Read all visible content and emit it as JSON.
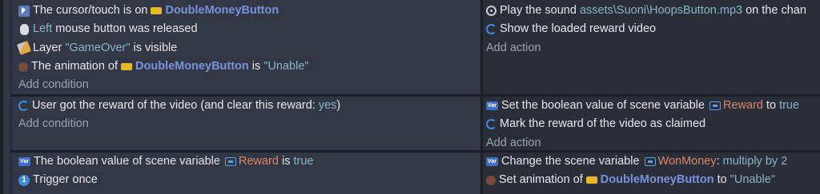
{
  "events": [
    {
      "conditions": [
        {
          "icon": "cursor-icon",
          "parts": [
            {
              "t": "The cursor/touch is on"
            },
            {
              "chip": true
            },
            {
              "t": "DoubleMoneyButton",
              "c": "obj"
            }
          ]
        },
        {
          "icon": "mouse-icon",
          "parts": [
            {
              "t": "Left",
              "c": "hl"
            },
            {
              "t": " mouse button was released"
            }
          ]
        },
        {
          "icon": "layer-icon",
          "parts": [
            {
              "t": "Layer "
            },
            {
              "t": "\"GameOver\"",
              "c": "str"
            },
            {
              "t": " is visible"
            }
          ]
        },
        {
          "icon": "animation-icon",
          "parts": [
            {
              "t": "The animation of"
            },
            {
              "chip": true
            },
            {
              "t": "DoubleMoneyButton",
              "c": "obj"
            },
            {
              "t": " is "
            },
            {
              "t": "\"Unable\"",
              "c": "str"
            }
          ]
        }
      ],
      "actions": [
        {
          "icon": "sound-icon",
          "parts": [
            {
              "t": "Play the sound "
            },
            {
              "t": "assets\\Suoni\\HoopsButton.mp3",
              "c": "hl"
            },
            {
              "t": " on the chan"
            }
          ]
        },
        {
          "icon": "loading-icon",
          "parts": [
            {
              "t": "Show the loaded reward video"
            }
          ]
        }
      ],
      "add_condition": "Add condition",
      "add_action": "Add action"
    },
    {
      "conditions": [
        {
          "icon": "loading-icon",
          "parts": [
            {
              "t": "User got the reward of the video (and clear this reward: "
            },
            {
              "t": "yes",
              "c": "hl"
            },
            {
              "t": ")"
            }
          ]
        }
      ],
      "actions": [
        {
          "icon": "variable-icon",
          "parts": [
            {
              "t": "Set the boolean value of scene variable"
            },
            {
              "varicon": true
            },
            {
              "t": "Reward",
              "c": "var"
            },
            {
              "t": " to "
            },
            {
              "t": "true",
              "c": "valt"
            }
          ]
        },
        {
          "icon": "loading-icon",
          "parts": [
            {
              "t": "Mark the reward of the video as claimed"
            }
          ]
        }
      ],
      "add_condition": "Add condition",
      "add_action": "Add action"
    },
    {
      "conditions": [
        {
          "icon": "variable-icon",
          "parts": [
            {
              "t": "The boolean value of scene variable"
            },
            {
              "varicon": true
            },
            {
              "t": "Reward",
              "c": "var"
            },
            {
              "t": " is "
            },
            {
              "t": "true",
              "c": "valt"
            }
          ]
        },
        {
          "icon": "trigger-once-icon",
          "parts": [
            {
              "t": "Trigger once"
            }
          ]
        }
      ],
      "actions": [
        {
          "icon": "variable-icon",
          "parts": [
            {
              "t": "Change the scene variable"
            },
            {
              "varicon": true
            },
            {
              "t": "WonMoney",
              "c": "var"
            },
            {
              "t": ": "
            },
            {
              "t": "multiply by",
              "c": "hl"
            },
            {
              "t": " "
            },
            {
              "t": "2",
              "c": "hl"
            }
          ]
        },
        {
          "icon": "animation-icon",
          "parts": [
            {
              "t": "Set animation of"
            },
            {
              "chip": true
            },
            {
              "t": "DoubleMoneyButton",
              "c": "obj"
            },
            {
              "t": " to "
            },
            {
              "t": "\"Unable\"",
              "c": "str"
            }
          ]
        }
      ],
      "add_condition": "",
      "add_action": ""
    }
  ],
  "icon_glyphs": {
    "trigger-once-icon": "1",
    "variable-icon": "Var"
  }
}
